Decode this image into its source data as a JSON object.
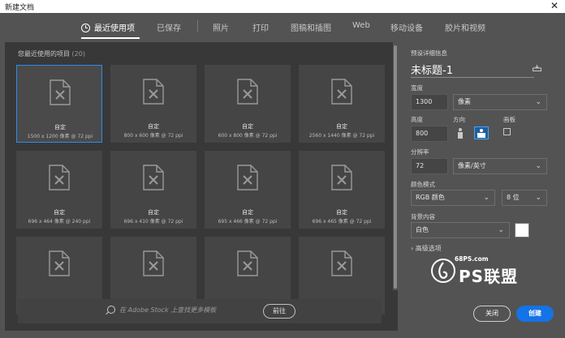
{
  "window": {
    "title": "新建文档",
    "close_glyph": "✕"
  },
  "tabs": [
    {
      "label": "最近使用项",
      "active": true
    },
    {
      "label": "已保存"
    },
    {
      "label": "照片"
    },
    {
      "label": "打印"
    },
    {
      "label": "图稿和插图"
    },
    {
      "label": "Web"
    },
    {
      "label": "移动设备"
    },
    {
      "label": "胶片和视频"
    }
  ],
  "recent": {
    "label": "您最近使用的项目",
    "count": "(20)",
    "items": [
      {
        "name": "自定",
        "size": "1500 x 1200 像素 @ 72 ppi",
        "selected": true
      },
      {
        "name": "自定",
        "size": "800 x 600 像素 @ 72 ppi"
      },
      {
        "name": "自定",
        "size": "600 x 800 像素 @ 72 ppi"
      },
      {
        "name": "自定",
        "size": "2560 x 1440 像素 @ 72 ppi"
      },
      {
        "name": "自定",
        "size": "696 x 464 像素 @ 240 ppi"
      },
      {
        "name": "自定",
        "size": "696 x 410 像素 @ 72 ppi"
      },
      {
        "name": "自定",
        "size": "695 x 466 像素 @ 72 ppi"
      },
      {
        "name": "自定",
        "size": "696 x 465 像素 @ 72 ppi"
      },
      {
        "name": "",
        "size": ""
      },
      {
        "name": "",
        "size": ""
      },
      {
        "name": "",
        "size": ""
      },
      {
        "name": "",
        "size": ""
      }
    ]
  },
  "stock": {
    "placeholder": "在 Adobe Stock 上查找更多模板",
    "go_label": "前往"
  },
  "details": {
    "section_label": "预设详细信息",
    "doc_name": "未标题-1",
    "width_label": "宽度",
    "width_value": "1300",
    "width_unit": "像素",
    "height_label": "高度",
    "height_value": "800",
    "orientation_label": "方向",
    "artboard_label": "画板",
    "resolution_label": "分辨率",
    "resolution_value": "72",
    "resolution_unit": "像素/英寸",
    "color_mode_label": "颜色模式",
    "color_mode_value": "RGB 颜色",
    "bit_depth_value": "8 位",
    "background_label": "背景内容",
    "background_value": "白色",
    "background_color": "#ffffff",
    "advanced_label": "高级选项",
    "advanced_glyph": "›"
  },
  "buttons": {
    "close_label": "关闭",
    "create_label": "创建"
  },
  "watermark": {
    "sub": "68PS.com",
    "main": "PS联盟"
  },
  "colors": {
    "accent": "#1473e6",
    "selection": "#2d8ceb"
  }
}
